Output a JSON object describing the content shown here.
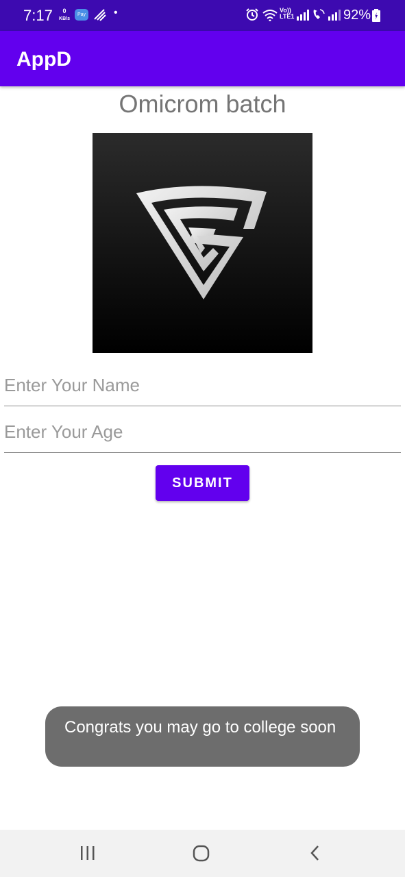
{
  "status_bar": {
    "time": "7:17",
    "speed_value": "0",
    "speed_unit": "KB/s",
    "pay_label": "Pay",
    "dot": "•",
    "volte_top": "Vo))",
    "volte_bottom": "LTE1",
    "battery": "92%",
    "icons": [
      "nfc-icon",
      "alarm-icon",
      "wifi-icon",
      "signal-icon",
      "call-icon",
      "battery-icon"
    ]
  },
  "app_bar": {
    "title": "AppD"
  },
  "main": {
    "heading": "Omicrom batch",
    "logo_icon": "g-logo-icon",
    "name_placeholder": "Enter Your Name",
    "age_placeholder": "Enter Your Age",
    "submit_label": "SUBMIT"
  },
  "toast": {
    "message": "Congrats you may go to college soon"
  },
  "nav_bar": {
    "icons": [
      "recents-icon",
      "home-icon",
      "back-icon"
    ]
  },
  "colors": {
    "status_bar": "#3d0ab0",
    "primary": "#6200ee",
    "toast_bg": "#6d6d6d",
    "heading_text": "#757575"
  }
}
